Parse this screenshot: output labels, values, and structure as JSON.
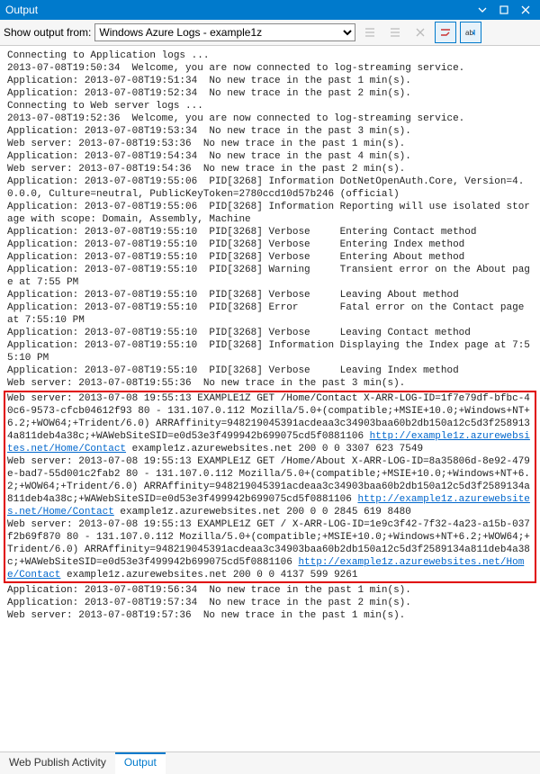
{
  "window": {
    "title": "Output"
  },
  "toolbar": {
    "label": "Show output from:",
    "dropdown_value": "Windows Azure Logs - example1z"
  },
  "tabs": {
    "publish": "Web Publish Activity",
    "output": "Output"
  },
  "log": {
    "pre1": "Connecting to Application logs ...\n2013-07-08T19:50:34  Welcome, you are now connected to log-streaming service.\nApplication: 2013-07-08T19:51:34  No new trace in the past 1 min(s).\nApplication: 2013-07-08T19:52:34  No new trace in the past 2 min(s).\nConnecting to Web server logs ...\n2013-07-08T19:52:36  Welcome, you are now connected to log-streaming service.\nApplication: 2013-07-08T19:53:34  No new trace in the past 3 min(s).\nWeb server: 2013-07-08T19:53:36  No new trace in the past 1 min(s).\nApplication: 2013-07-08T19:54:34  No new trace in the past 4 min(s).\nWeb server: 2013-07-08T19:54:36  No new trace in the past 2 min(s).\nApplication: 2013-07-08T19:55:06  PID[3268] Information DotNetOpenAuth.Core, Version=4.0.0.0, Culture=neutral, PublicKeyToken=2780ccd10d57b246 (official)\nApplication: 2013-07-08T19:55:06  PID[3268] Information Reporting will use isolated storage with scope: Domain, Assembly, Machine\nApplication: 2013-07-08T19:55:10  PID[3268] Verbose     Entering Contact method\nApplication: 2013-07-08T19:55:10  PID[3268] Verbose     Entering Index method\nApplication: 2013-07-08T19:55:10  PID[3268] Verbose     Entering About method\nApplication: 2013-07-08T19:55:10  PID[3268] Warning     Transient error on the About page at 7:55 PM\nApplication: 2013-07-08T19:55:10  PID[3268] Verbose     Leaving About method\nApplication: 2013-07-08T19:55:10  PID[3268] Error       Fatal error on the Contact page at 7:55:10 PM\nApplication: 2013-07-08T19:55:10  PID[3268] Verbose     Leaving Contact method\nApplication: 2013-07-08T19:55:10  PID[3268] Information Displaying the Index page at 7:55:10 PM\nApplication: 2013-07-08T19:55:10  PID[3268] Verbose     Leaving Index method\nWeb server: 2013-07-08T19:55:36  No new trace in the past 3 min(s).",
    "box_a1": "Web server: 2013-07-08 19:55:13 EXAMPLE1Z GET /Home/Contact X-ARR-LOG-ID=1f7e79df-bfbc-40c6-9573-cfcb04612f93 80 - 131.107.0.112 Mozilla/5.0+(compatible;+MSIE+10.0;+Windows+NT+6.2;+WOW64;+Trident/6.0) ARRAffinity=948219045391acdeaa3c34903baa60b2db150a12c5d3f2589134a811deb4a38c;+WAWebSiteSID=e0d53e3f499942b699075cd5f0881106 ",
    "link1": "http://example1z.azurewebsites.net/Home/Contact",
    "box_a2": " example1z.azurewebsites.net 200 0 0 3307 623 7549\nWeb server: 2013-07-08 19:55:13 EXAMPLE1Z GET /Home/About X-ARR-LOG-ID=8a35806d-8e92-479e-bad7-55d001c2fab2 80 - 131.107.0.112 Mozilla/5.0+(compatible;+MSIE+10.0;+Windows+NT+6.2;+WOW64;+Trident/6.0) ARRAffinity=948219045391acdeaa3c34903baa60b2db150a12c5d3f2589134a811deb4a38c;+WAWebSiteSID=e0d53e3f499942b699075cd5f0881106 ",
    "link2": "http://example1z.azurewebsites.net/Home/Contact",
    "box_a3": " example1z.azurewebsites.net 200 0 0 2845 619 8480\nWeb server: 2013-07-08 19:55:13 EXAMPLE1Z GET / X-ARR-LOG-ID=1e9c3f42-7f32-4a23-a15b-037f2b69f870 80 - 131.107.0.112 Mozilla/5.0+(compatible;+MSIE+10.0;+Windows+NT+6.2;+WOW64;+Trident/6.0) ARRAffinity=948219045391acdeaa3c34903baa60b2db150a12c5d3f2589134a811deb4a38c;+WAWebSiteSID=e0d53e3f499942b699075cd5f0881106 ",
    "link3": "http://example1z.azurewebsites.net/Home/Contact",
    "box_a4": " example1z.azurewebsites.net 200 0 0 4137 599 9261",
    "post1": "Application: 2013-07-08T19:56:34  No new trace in the past 1 min(s).\nApplication: 2013-07-08T19:57:34  No new trace in the past 2 min(s).\nWeb server: 2013-07-08T19:57:36  No new trace in the past 1 min(s).\n"
  }
}
